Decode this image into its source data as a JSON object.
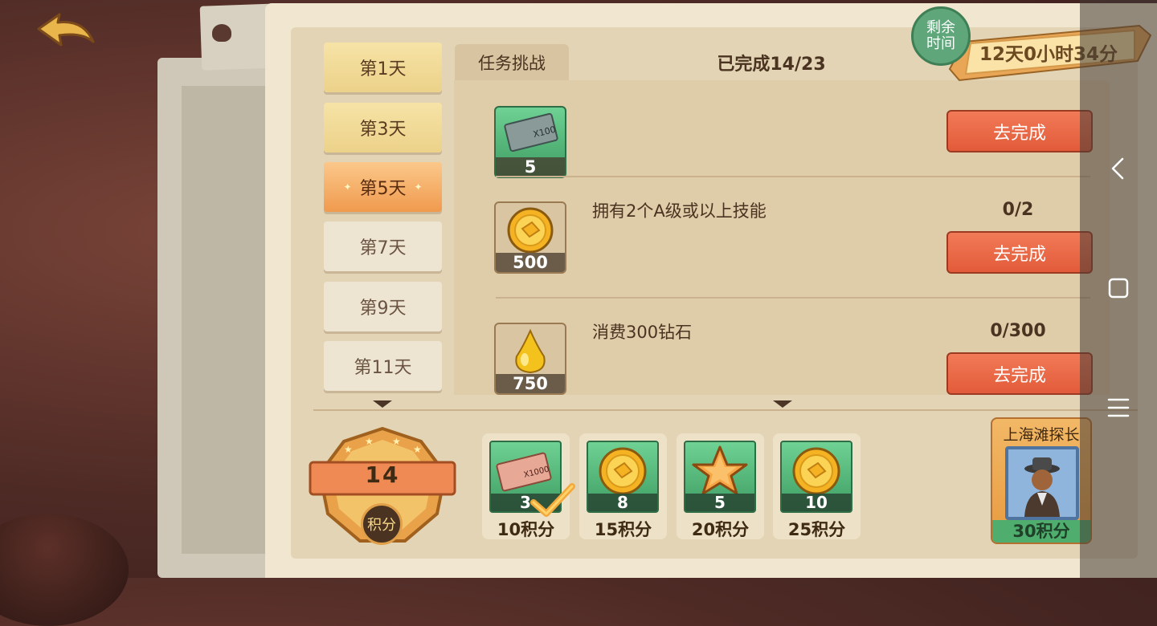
{
  "days": [
    {
      "label": "第1天",
      "state": "unlocked"
    },
    {
      "label": "第3天",
      "state": "unlocked"
    },
    {
      "label": "第5天",
      "state": "active"
    },
    {
      "label": "第7天",
      "state": "locked"
    },
    {
      "label": "第9天",
      "state": "locked"
    },
    {
      "label": "第11天",
      "state": "locked"
    }
  ],
  "task_panel": {
    "tab_label": "任务挑战",
    "completed_text": "已完成14/23"
  },
  "tasks": [
    {
      "name": "",
      "progress": "",
      "reward_icon": "cash-ticket-x100-icon",
      "reward_qty": "5",
      "ticket_text": "X100",
      "button": "去完成"
    },
    {
      "name": "拥有2个A级或以上技能",
      "progress": "0/2",
      "reward_icon": "gold-coin-icon",
      "reward_qty": "500",
      "button": "去完成"
    },
    {
      "name": "消费300钻石",
      "progress": "0/300",
      "reward_icon": "oil-drop-icon",
      "reward_qty": "750",
      "button": "去完成"
    }
  ],
  "score": {
    "value": "14",
    "label": "积分"
  },
  "milestones": [
    {
      "icon": "cash-ticket-x1000-icon",
      "qty": "3",
      "points": "10积分",
      "ticket_text": "X1000",
      "claimed": true
    },
    {
      "icon": "gold-coin-icon",
      "qty": "8",
      "points": "15积分",
      "claimed": false
    },
    {
      "icon": "star-icon",
      "qty": "5",
      "points": "20积分",
      "claimed": false
    },
    {
      "icon": "gold-coin-icon",
      "qty": "10",
      "points": "25积分",
      "claimed": false
    }
  ],
  "title_reward": {
    "name": "上海滩探长",
    "points": "30积分",
    "icon": "detective-avatar-icon"
  },
  "timer": {
    "label": "剩余时间",
    "label_line1": "剩余",
    "label_line2": "时间",
    "value": "12天0小时34分"
  },
  "colors": {
    "panel": "#f1e6cf",
    "go_button": "#e9684a",
    "active_day": "#f5ad68",
    "reward_green": "#4fae6e"
  }
}
